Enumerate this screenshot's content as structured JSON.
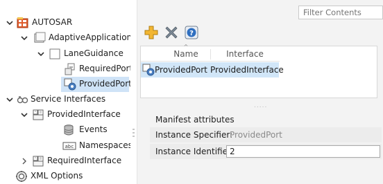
{
  "tree": {
    "items": [
      {
        "id": "autosar",
        "label": "AUTOSAR",
        "icon": "autosar-package-icon",
        "expanded": true
      },
      {
        "id": "adaptive-applications",
        "label": "AdaptiveApplications",
        "icon": "folder-icon",
        "expanded": true
      },
      {
        "id": "lane-guidance",
        "label": "LaneGuidance",
        "icon": "component-icon",
        "expanded": true
      },
      {
        "id": "required-ports",
        "label": "RequiredPorts",
        "icon": "required-port-icon"
      },
      {
        "id": "provided-ports",
        "label": "ProvidedPorts",
        "icon": "provided-port-icon",
        "selected": true
      },
      {
        "id": "service-interfaces",
        "label": "Service Interfaces",
        "icon": "service-interfaces-icon",
        "expanded": true
      },
      {
        "id": "provided-interface",
        "label": "ProvidedInterface",
        "icon": "interface-icon",
        "expanded": true
      },
      {
        "id": "events",
        "label": "Events",
        "icon": "events-icon"
      },
      {
        "id": "namespaces",
        "label": "Namespaces",
        "icon": "abc-namespace-icon"
      },
      {
        "id": "required-interface",
        "label": "RequiredInterface",
        "icon": "interface-icon",
        "expanded": false
      },
      {
        "id": "xml-options",
        "label": "XML Options",
        "icon": "xml-options-icon"
      }
    ]
  },
  "toolbar": {
    "add_icon": "add-icon",
    "delete_icon": "delete-icon",
    "help_icon": "help-icon"
  },
  "filter": {
    "placeholder": "Filter Contents"
  },
  "table": {
    "columns": [
      "Name",
      "Interface"
    ],
    "rows": [
      {
        "name": "ProvidedPort",
        "interface": "ProvidedInterface"
      }
    ]
  },
  "manifest": {
    "title": "Manifest attributes",
    "instance_specifier_label": "Instance Specifier:",
    "instance_specifier_value": "ProvidedPort",
    "instance_identifier_label": "Instance Identifier:",
    "instance_identifier_value": "2"
  },
  "colors": {
    "selection": "#cfe3f7",
    "add_icon": "#f2b632",
    "delete_icon": "#7b8894",
    "help_icon": "#2f6fc0"
  }
}
